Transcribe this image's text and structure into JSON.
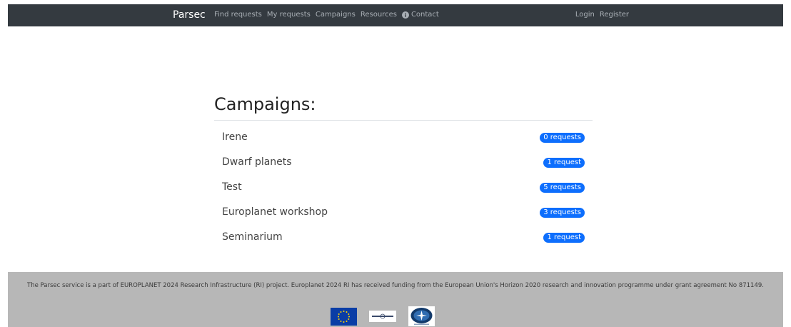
{
  "nav": {
    "brand": "Parsec",
    "links": [
      "Find requests",
      "My requests",
      "Campaigns",
      "Resources",
      "Contact"
    ],
    "auth": [
      "Login",
      "Register"
    ]
  },
  "main": {
    "title": "Campaigns:",
    "campaigns": [
      {
        "name": "Irene",
        "badge": "0 requests"
      },
      {
        "name": "Dwarf planets",
        "badge": "1 request"
      },
      {
        "name": "Test",
        "badge": "5 requests"
      },
      {
        "name": "Europlanet workshop",
        "badge": "3 requests"
      },
      {
        "name": "Seminarium",
        "badge": "1 request"
      }
    ]
  },
  "footer": {
    "text": "The Parsec service is a part of EUROPLANET 2024 Research Infrastructure (RI) project. Europlanet 2024 RI has received funding from the European Union's Horizon 2020 research and innovation programme under grant agreement No 871149.",
    "logos": [
      "eu-flag-logo",
      "europlanet-logo",
      "observatory-seal-logo"
    ]
  },
  "colors": {
    "navbar": "#343a40",
    "badge": "#0d6efd",
    "footer": "#b7b7b7"
  }
}
